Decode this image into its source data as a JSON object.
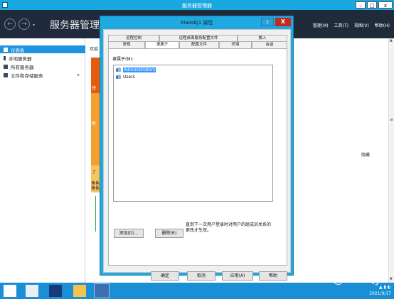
{
  "window": {
    "title": "服务器管理器",
    "controls": {
      "minimize": "–",
      "maximize": "□",
      "close": "x"
    }
  },
  "header": {
    "back": "←",
    "forward": "→",
    "dropdown": "▾",
    "title": "服务器管理器",
    "menus": [
      "管理(M)",
      "工具(T)",
      "视图(V)",
      "帮助(H)"
    ]
  },
  "sidebar": {
    "items": [
      {
        "label": "仪表板",
        "active": true
      },
      {
        "label": "本地服务器",
        "active": false
      },
      {
        "label": "所有服务器",
        "active": false
      },
      {
        "label": "文件和存储服务",
        "active": false,
        "arrow": "▸"
      }
    ]
  },
  "main": {
    "welcome": "欢迎",
    "tile_labels": [
      "快",
      "新",
      "了"
    ],
    "roles_line1": "角色",
    "roles_line2": "角色",
    "hide": "隐藏",
    "scroll_up": "▲",
    "scroll_mid": "≡",
    "scroll_down": "▼"
  },
  "dialog": {
    "title": "Xiaosbj1 属性",
    "help": "?",
    "close": "X",
    "tabs_row1": [
      "远程控制",
      "远程桌面服务配置文件",
      "拨入"
    ],
    "tabs_row2": [
      "常规",
      "隶属于",
      "配置文件",
      "环境",
      "会话"
    ],
    "active_tab": "隶属于",
    "member_of_label": "隶属于(M):",
    "members": [
      {
        "name": "Administrators",
        "selected": true
      },
      {
        "name": "Users",
        "selected": false
      }
    ],
    "add_button": "添加(D)...",
    "remove_button": "删除(R)",
    "note": "直到下一次用户登录时对用户的组成员关系的更改才生效。",
    "ok": "确定",
    "cancel": "取消",
    "apply": "应用(A)",
    "help_button": "帮助"
  },
  "taskbar": {
    "date": "2021/9/17"
  },
  "watermark": "CSDN @LSZQJ"
}
